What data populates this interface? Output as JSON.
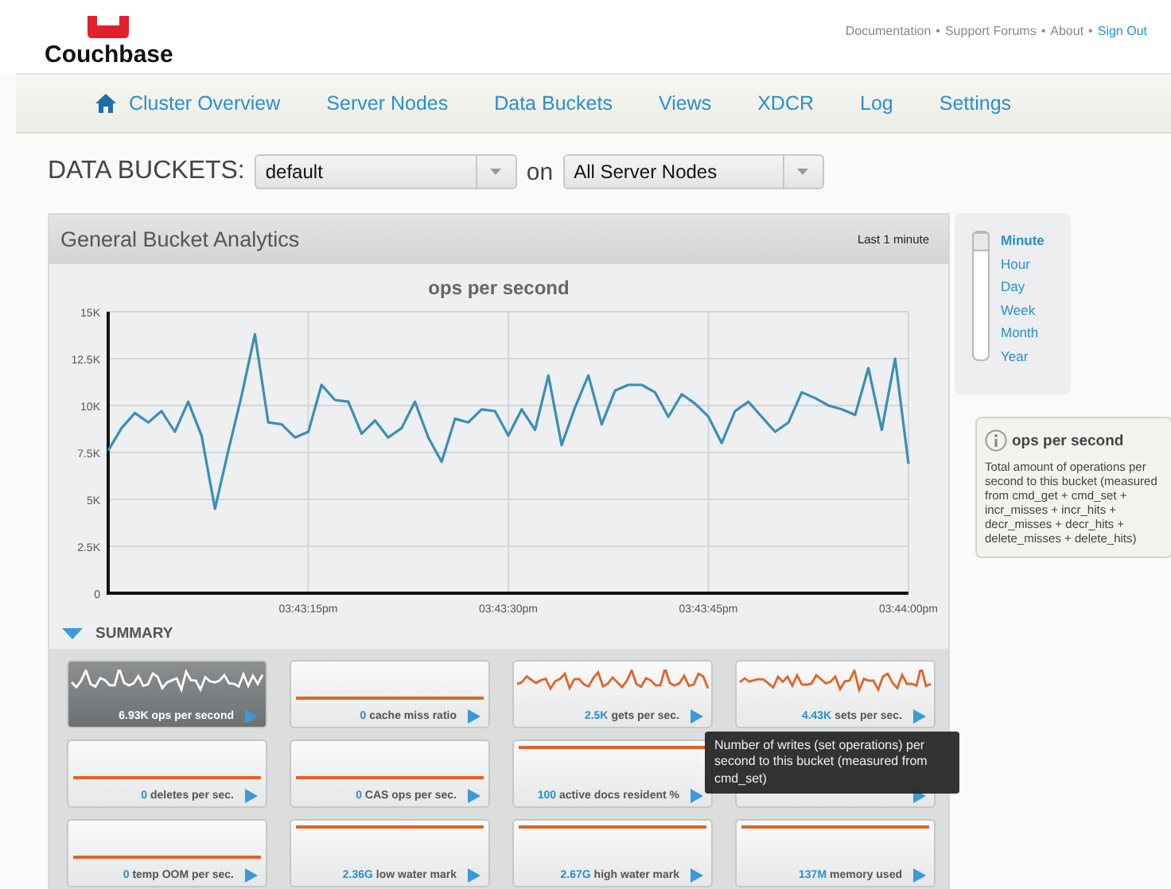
{
  "header": {
    "logo_text": "Couchbase",
    "separator": "•",
    "links": [
      {
        "label": "Documentation",
        "kind": "plain"
      },
      {
        "label": "Support Forums",
        "kind": "plain"
      },
      {
        "label": "About",
        "kind": "plain"
      },
      {
        "label": "Sign Out",
        "kind": "accent"
      }
    ]
  },
  "nav": {
    "items": [
      {
        "label": "Cluster Overview",
        "kind": "home"
      },
      {
        "label": "Server Nodes",
        "kind": "plain"
      },
      {
        "label": "Data Buckets",
        "kind": "plain"
      },
      {
        "label": "Views",
        "kind": "plain"
      },
      {
        "label": "XDCR",
        "kind": "plain"
      },
      {
        "label": "Log",
        "kind": "plain"
      },
      {
        "label": "Settings",
        "kind": "plain"
      }
    ]
  },
  "selector": {
    "label": "DATA BUCKETS:",
    "bucket": "default",
    "joiner": "on",
    "nodes": "All Server Nodes"
  },
  "analytics": {
    "title": "General Bucket Analytics",
    "range": "Last 1 minute",
    "chart_data": {
      "type": "line",
      "title": "ops per second",
      "categories": [
        null,
        null,
        null,
        null,
        null,
        null,
        null,
        null,
        null,
        null,
        null,
        null,
        null,
        null,
        null,
        "03:43:15pm",
        null,
        null,
        null,
        null,
        null,
        null,
        null,
        null,
        null,
        null,
        null,
        null,
        null,
        null,
        "03:43:30pm",
        null,
        null,
        null,
        null,
        null,
        null,
        null,
        null,
        null,
        null,
        null,
        null,
        null,
        null,
        "03:43:45pm",
        null,
        null,
        null,
        null,
        null,
        null,
        null,
        null,
        null,
        null,
        null,
        null,
        null,
        null,
        "03:44:00pm"
      ],
      "series": [
        {
          "color": "#3a8fb7",
          "values": [
            7600,
            8800,
            9600,
            9100,
            9700,
            8600,
            10200,
            8400,
            4500,
            7600,
            10500,
            13800,
            9100,
            9000,
            8300,
            8600,
            11100,
            10300,
            10200,
            8500,
            9200,
            8300,
            8800,
            10200,
            8300,
            7000,
            9300,
            9100,
            9800,
            9700,
            8400,
            9800,
            8700,
            11600,
            7900,
            9900,
            11600,
            9000,
            10800,
            11100,
            11100,
            10700,
            9400,
            10600,
            10100,
            9400,
            8000,
            9700,
            10200,
            9400,
            8600,
            9100,
            10700,
            10400,
            10000,
            9800,
            9500,
            12000,
            8700,
            12500,
            6900
          ]
        }
      ],
      "ylim": [
        0,
        15000
      ],
      "grid": true,
      "yticks": [
        {
          "value": 0,
          "label": "0"
        },
        {
          "value": 2500,
          "label": "2.5K"
        },
        {
          "value": 5000,
          "label": "5K"
        },
        {
          "value": 7500,
          "label": "7.5K"
        },
        {
          "value": 10000,
          "label": "10K"
        },
        {
          "value": 12500,
          "label": "12.5K"
        },
        {
          "value": 15000,
          "label": "15K"
        }
      ]
    }
  },
  "periods": [
    {
      "label": "Minute",
      "selected": true
    },
    {
      "label": "Hour",
      "selected": false
    },
    {
      "label": "Day",
      "selected": false
    },
    {
      "label": "Week",
      "selected": false
    },
    {
      "label": "Month",
      "selected": false
    },
    {
      "label": "Year",
      "selected": false
    }
  ],
  "info": {
    "title": "ops per second",
    "text": "Total amount of operations per second to this bucket (measured from cmd_get + cmd_set + incr_misses + incr_hits + decr_misses + decr_hits + delete_misses + delete_hits)"
  },
  "summary": {
    "title": "SUMMARY",
    "expanded": true,
    "tiles": [
      {
        "value": "6.93K",
        "label": "ops per second",
        "kind": "wave",
        "selected": true
      },
      {
        "value": "0",
        "label": "cache miss ratio",
        "kind": "low",
        "selected": false
      },
      {
        "value": "2.5K",
        "label": "gets per sec.",
        "kind": "wave",
        "selected": false
      },
      {
        "value": "4.43K",
        "label": "sets per sec.",
        "kind": "wave",
        "selected": false
      },
      {
        "value": "0",
        "label": "deletes per sec.",
        "kind": "low",
        "selected": false
      },
      {
        "value": "0",
        "label": "CAS ops per sec.",
        "kind": "low",
        "selected": false
      },
      {
        "value": "100",
        "label": "active docs resident %",
        "kind": "high",
        "selected": false
      },
      {
        "kind": "blank",
        "selected": false
      },
      {
        "value": "0",
        "label": "temp OOM per sec.",
        "kind": "low",
        "selected": false
      },
      {
        "value": "2.36G",
        "label": "low water mark",
        "kind": "high",
        "selected": false
      },
      {
        "value": "2.67G",
        "label": "high water mark",
        "kind": "high",
        "selected": false
      },
      {
        "value": "137M",
        "label": "memory used",
        "kind": "high",
        "selected": false
      }
    ]
  },
  "tooltip": {
    "text": "Number of writes (set operations) per second to this bucket (measured from cmd_set)"
  }
}
